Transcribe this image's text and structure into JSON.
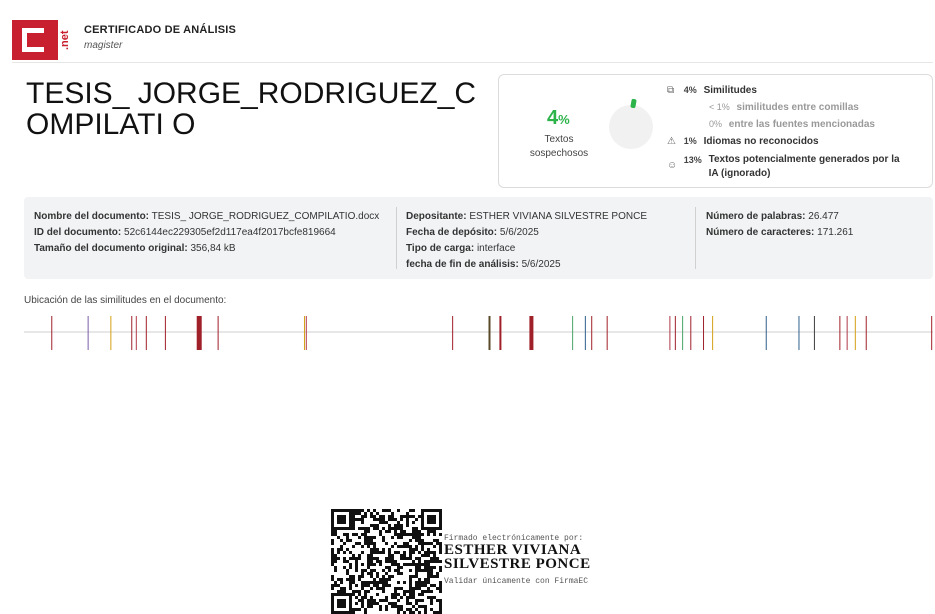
{
  "header": {
    "logo_text": ".net",
    "title": "CERTIFICADO DE ANÁLISIS",
    "subtitle": "magister"
  },
  "document": {
    "title": "TESIS_ JORGE_RODRIGUEZ_COMPILATI O"
  },
  "stats": {
    "suspicious_pct": "4",
    "suspicious_unit": "%",
    "suspicious_label": "Textos sospechosos",
    "similitudes": {
      "pct": "4%",
      "label": "Similitudes"
    },
    "quotes": {
      "pct": "< 1%",
      "label": "similitudes entre comillas"
    },
    "sources": {
      "pct": "0%",
      "label": "entre las fuentes mencionadas"
    },
    "languages": {
      "pct": "1%",
      "label": "Idiomas no reconocidos"
    },
    "ai": {
      "pct": "13%",
      "label": "Textos potencialmente generados por la IA (ignorado)"
    }
  },
  "meta": {
    "col1": [
      {
        "k": "Nombre del documento:",
        "v": "TESIS_ JORGE_RODRIGUEZ_COMPILATIO.docx"
      },
      {
        "k": "ID del documento:",
        "v": "52c6144ec229305ef2d117ea4f2017bcfe819664"
      },
      {
        "k": "Tamaño del documento original:",
        "v": "356,84 kB"
      }
    ],
    "col2": [
      {
        "k": "Depositante:",
        "v": "ESTHER VIVIANA SILVESTRE PONCE"
      },
      {
        "k": "Fecha de depósito:",
        "v": "5/6/2025"
      },
      {
        "k": "Tipo de carga:",
        "v": "interface"
      },
      {
        "k": "fecha de fin de análisis:",
        "v": "5/6/2025"
      }
    ],
    "col3": [
      {
        "k": "Número de palabras:",
        "v": "26.477"
      },
      {
        "k": "Número de caracteres:",
        "v": "171.261"
      }
    ]
  },
  "location": {
    "label": "Ubicación de las similitudes en el documento:",
    "marks": [
      {
        "pos": 0.03,
        "color": "#a0202a",
        "w": 1
      },
      {
        "pos": 0.07,
        "color": "#7b5ea7",
        "w": 1
      },
      {
        "pos": 0.095,
        "color": "#d4a017",
        "w": 1
      },
      {
        "pos": 0.118,
        "color": "#a0202a",
        "w": 1
      },
      {
        "pos": 0.123,
        "color": "#b03a48",
        "w": 1
      },
      {
        "pos": 0.134,
        "color": "#a0202a",
        "w": 1
      },
      {
        "pos": 0.155,
        "color": "#a0202a",
        "w": 1
      },
      {
        "pos": 0.19,
        "color": "#a0202a",
        "w": 5
      },
      {
        "pos": 0.213,
        "color": "#a0202a",
        "w": 1
      },
      {
        "pos": 0.308,
        "color": "#d4a017",
        "w": 1
      },
      {
        "pos": 0.31,
        "color": "#b03a48",
        "w": 1
      },
      {
        "pos": 0.471,
        "color": "#a0202a",
        "w": 1
      },
      {
        "pos": 0.511,
        "color": "#5a4a2a",
        "w": 2
      },
      {
        "pos": 0.523,
        "color": "#a0202a",
        "w": 2
      },
      {
        "pos": 0.556,
        "color": "#a0202a",
        "w": 4
      },
      {
        "pos": 0.603,
        "color": "#4aa36a",
        "w": 1
      },
      {
        "pos": 0.617,
        "color": "#2e5f8a",
        "w": 1
      },
      {
        "pos": 0.624,
        "color": "#a0202a",
        "w": 1
      },
      {
        "pos": 0.641,
        "color": "#a0202a",
        "w": 1
      },
      {
        "pos": 0.71,
        "color": "#b03a48",
        "w": 1
      },
      {
        "pos": 0.716,
        "color": "#a0202a",
        "w": 1
      },
      {
        "pos": 0.724,
        "color": "#4aa36a",
        "w": 1
      },
      {
        "pos": 0.733,
        "color": "#a0202a",
        "w": 1
      },
      {
        "pos": 0.747,
        "color": "#a0202a",
        "w": 1
      },
      {
        "pos": 0.757,
        "color": "#d4a017",
        "w": 1
      },
      {
        "pos": 0.816,
        "color": "#2e5f8a",
        "w": 1
      },
      {
        "pos": 0.852,
        "color": "#2e5f8a",
        "w": 1
      },
      {
        "pos": 0.869,
        "color": "#3d3d3d",
        "w": 1
      },
      {
        "pos": 0.897,
        "color": "#a0202a",
        "w": 1
      },
      {
        "pos": 0.905,
        "color": "#b03a48",
        "w": 1
      },
      {
        "pos": 0.914,
        "color": "#d4a017",
        "w": 1
      },
      {
        "pos": 0.926,
        "color": "#a0202a",
        "w": 1
      },
      {
        "pos": 0.998,
        "color": "#a0202a",
        "w": 1
      }
    ]
  },
  "signature": {
    "line1": "Firmado electrónicamente por:",
    "name1": "ESTHER VIVIANA",
    "name2": "SILVESTRE PONCE",
    "line3": "Validar únicamente con FirmaEC"
  },
  "colors": {
    "brand": "#c8202f",
    "accent_green": "#2cb34a",
    "panel_bg": "#f1f3f5"
  }
}
